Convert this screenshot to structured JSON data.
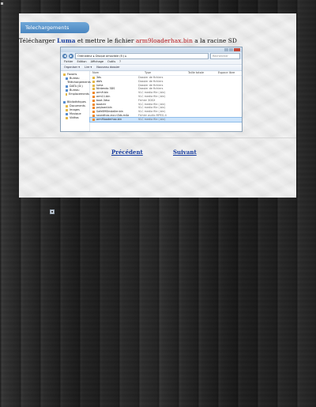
{
  "banner": {
    "label": "Telechargements"
  },
  "instruction": {
    "prefix": "Télécharger ",
    "app_name": "Luma",
    "middle": " et mettre le fichier ",
    "filename": "arm9loaderhax.bin",
    "suffix": " a la racine SD"
  },
  "explorer": {
    "address": "Ordinateur ▸ Disque amovible (E:) ▸",
    "search_placeholder": "Rechercher",
    "menu": [
      "Fichier",
      "Edition",
      "Affichage",
      "Outils",
      "?"
    ],
    "toolbar": [
      "Organiser ▾",
      "Lire ▾",
      "Nouveau dossier"
    ],
    "columns": {
      "name": "Nom",
      "date": "Type",
      "size": "Taille totale",
      "type": "Espace libre"
    },
    "nav": [
      {
        "label": "Favoris",
        "indent": false,
        "blue": false
      },
      {
        "label": "Bureau",
        "indent": true,
        "blue": true
      },
      {
        "label": "Téléchargements",
        "indent": true,
        "blue": false
      },
      {
        "label": "DATA (D:)",
        "indent": true,
        "blue": true
      },
      {
        "label": "Bureau",
        "indent": true,
        "blue": true
      },
      {
        "label": "Emplacements",
        "indent": true,
        "blue": false
      },
      {
        "label": "",
        "indent": false,
        "blue": false
      },
      {
        "label": "Bibliothèques",
        "indent": false,
        "blue": true
      },
      {
        "label": "Documents",
        "indent": true,
        "blue": false
      },
      {
        "label": "Images",
        "indent": true,
        "blue": false
      },
      {
        "label": "Musique",
        "indent": true,
        "blue": true
      },
      {
        "label": "Vidéos",
        "indent": true,
        "blue": false
      }
    ],
    "files": [
      {
        "name": "3ds",
        "type": "Dossier de fichiers",
        "kind": "folder",
        "selected": false
      },
      {
        "name": "dbfs",
        "type": "Dossier de fichiers",
        "kind": "folder",
        "selected": false
      },
      {
        "name": "luma",
        "type": "Dossier de fichiers",
        "kind": "folder",
        "selected": false
      },
      {
        "name": "Nintendo 3DS",
        "type": "Dossier de fichiers",
        "kind": "folder",
        "selected": false
      },
      {
        "name": "arm9.bin",
        "type": "VLC media file (.bin)",
        "kind": "file",
        "selected": false
      },
      {
        "name": "arm11.bin",
        "type": "VLC media file (.bin)",
        "kind": "file",
        "selected": false
      },
      {
        "name": "boot.3dsx",
        "type": "Fichier 3DSX",
        "kind": "file",
        "selected": false
      },
      {
        "name": "bootctr",
        "type": "VLC media file (.bin)",
        "kind": "file",
        "selected": false
      },
      {
        "name": "payload.bin",
        "type": "VLC media file (.bin)",
        "kind": "file",
        "selected": false
      },
      {
        "name": "SafeB9SInstaller.bin",
        "type": "VLC media file (.bin)",
        "kind": "file",
        "selected": false
      },
      {
        "name": "soundhax-eur-n3ds.m4a",
        "type": "Fichier audio MPEG-4",
        "kind": "file",
        "selected": false
      },
      {
        "name": "arm9loaderhax.bin",
        "type": "VLC media file (.bin)",
        "kind": "file",
        "selected": true
      }
    ]
  },
  "pager": {
    "prev": "Précédent",
    "next": "Suivant"
  }
}
